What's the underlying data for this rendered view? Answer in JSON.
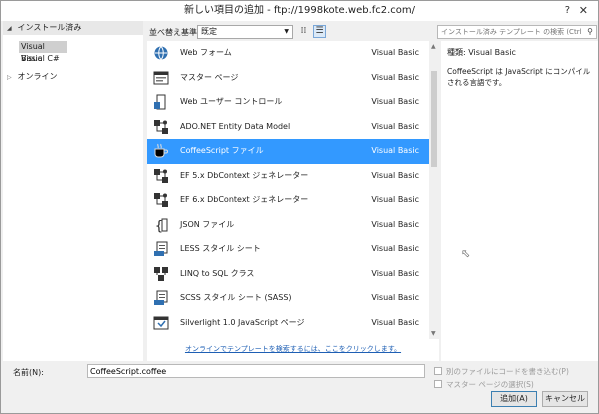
{
  "window": {
    "title": "新しい項目の追加 - ftp://1998kote.web.fc2.com/",
    "help_label": "?",
    "close_label": "✕"
  },
  "tree": {
    "installed_label": "インストール済み",
    "languages": [
      "Visual Basic",
      "Visual C#"
    ],
    "online_label": "オンライン"
  },
  "toolbar": {
    "sort_label": "並べ替え基準:",
    "sort_value": "既定",
    "search_placeholder": "インストール済み テンプレート の検索 (Ctrl+E)"
  },
  "templates": [
    {
      "name": "Web フォーム",
      "lang": "Visual Basic",
      "icon": "web-form-icon"
    },
    {
      "name": "マスター ページ",
      "lang": "Visual Basic",
      "icon": "master-page-icon"
    },
    {
      "name": "Web ユーザー コントロール",
      "lang": "Visual Basic",
      "icon": "user-control-icon"
    },
    {
      "name": "ADO.NET Entity Data Model",
      "lang": "Visual Basic",
      "icon": "entity-model-icon"
    },
    {
      "name": "CoffeeScript ファイル",
      "lang": "Visual Basic",
      "icon": "coffee-cup-icon",
      "selected": true
    },
    {
      "name": "EF 5.x DbContext ジェネレーター",
      "lang": "Visual Basic",
      "icon": "dbcontext-icon"
    },
    {
      "name": "EF 6.x DbContext ジェネレーター",
      "lang": "Visual Basic",
      "icon": "dbcontext-icon"
    },
    {
      "name": "JSON ファイル",
      "lang": "Visual Basic",
      "icon": "json-icon"
    },
    {
      "name": "LESS スタイル シート",
      "lang": "Visual Basic",
      "icon": "less-icon"
    },
    {
      "name": "LINQ to SQL クラス",
      "lang": "Visual Basic",
      "icon": "linq-icon"
    },
    {
      "name": "SCSS スタイル シート (SASS)",
      "lang": "Visual Basic",
      "icon": "scss-icon"
    },
    {
      "name": "Silverlight 1.0 JavaScript ページ",
      "lang": "Visual Basic",
      "icon": "silverlight-icon"
    }
  ],
  "online_link": "オンラインでテンプレートを検索するには、ここをクリックします。",
  "detail": {
    "type_label": "種類:",
    "type_value": "Visual Basic",
    "description": "CoffeeScript は JavaScript にコンパイルされる言語です。"
  },
  "footer": {
    "name_label": "名前(N):",
    "name_value": "CoffeeScript.coffee",
    "code_behind_label": "別のファイルにコードを書き込む(P)",
    "master_page_label": "マスター ページの選択(S)",
    "add_label": "追加(A)",
    "cancel_label": "キャンセル"
  },
  "colors": {
    "selection": "#3399ff",
    "panel_bg": "#f0f0f0",
    "link": "#1e5fb4"
  }
}
